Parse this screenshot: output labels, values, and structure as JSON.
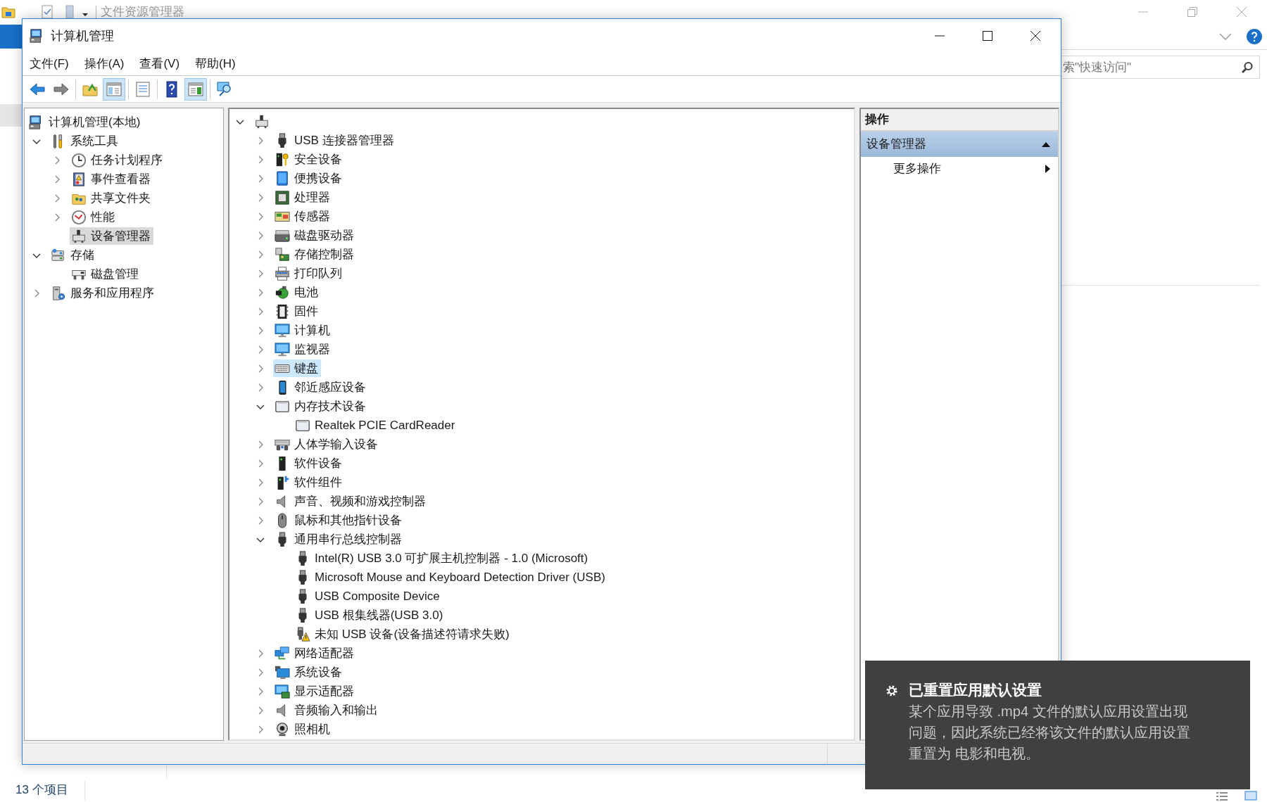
{
  "explorer": {
    "title": "文件资源管理器",
    "search": {
      "placeholder": "索\"快速访问\""
    },
    "status": "13 个项目"
  },
  "window": {
    "title": "计算机管理",
    "menu": [
      "文件(F)",
      "操作(A)",
      "查看(V)",
      "帮助(H)"
    ],
    "toolbar": [
      {
        "pressed": false
      },
      {
        "pressed": false
      },
      {
        "pressed": false
      },
      {
        "pressed": true
      },
      {
        "pressed": false
      },
      {
        "pressed": false
      },
      {
        "pressed": true
      },
      {
        "pressed": false
      }
    ],
    "nav_tree": {
      "label": "计算机管理(本地)",
      "selected": false,
      "children": [
        {
          "label": "系统工具",
          "expanded": true,
          "selected": false,
          "children": [
            {
              "label": "任务计划程序",
              "expanded": false,
              "selected": false
            },
            {
              "label": "事件查看器",
              "expanded": false,
              "selected": false
            },
            {
              "label": "共享文件夹",
              "expanded": false,
              "selected": false
            },
            {
              "label": "性能",
              "expanded": false,
              "selected": false
            },
            {
              "label": "设备管理器",
              "selected": true
            }
          ]
        },
        {
          "label": "存储",
          "expanded": true,
          "selected": false,
          "children": [
            {
              "label": "磁盘管理",
              "selected": false
            }
          ]
        },
        {
          "label": "服务和应用程序",
          "expanded": false,
          "selected": false
        }
      ]
    },
    "device_tree": {
      "expanded": true,
      "selected": false,
      "children": [
        {
          "label": "USB 连接器管理器",
          "expanded": false,
          "selected": false
        },
        {
          "label": "安全设备",
          "expanded": false,
          "selected": false
        },
        {
          "label": "便携设备",
          "expanded": false,
          "selected": false
        },
        {
          "label": "处理器",
          "expanded": false,
          "selected": false
        },
        {
          "label": "传感器",
          "expanded": false,
          "selected": false
        },
        {
          "label": "磁盘驱动器",
          "expanded": false,
          "selected": false
        },
        {
          "label": "存储控制器",
          "expanded": false,
          "selected": false
        },
        {
          "label": "打印队列",
          "expanded": false,
          "selected": false
        },
        {
          "label": "电池",
          "expanded": false,
          "selected": false
        },
        {
          "label": "固件",
          "expanded": false,
          "selected": false
        },
        {
          "label": "计算机",
          "expanded": false,
          "selected": false
        },
        {
          "label": "监视器",
          "expanded": false,
          "selected": false
        },
        {
          "label": "键盘",
          "expanded": false,
          "selected": true
        },
        {
          "label": "邻近感应设备",
          "expanded": false,
          "selected": false
        },
        {
          "label": "内存技术设备",
          "expanded": true,
          "selected": false,
          "children": [
            {
              "label": "Realtek PCIE CardReader",
              "selected": false
            }
          ]
        },
        {
          "label": "人体学输入设备",
          "expanded": false,
          "selected": false
        },
        {
          "label": "软件设备",
          "expanded": false,
          "selected": false
        },
        {
          "label": "软件组件",
          "expanded": false,
          "selected": false
        },
        {
          "label": "声音、视频和游戏控制器",
          "expanded": false,
          "selected": false
        },
        {
          "label": "鼠标和其他指针设备",
          "expanded": false,
          "selected": false
        },
        {
          "label": "通用串行总线控制器",
          "expanded": true,
          "selected": false,
          "children": [
            {
              "label": "Intel(R) USB 3.0 可扩展主机控制器 - 1.0 (Microsoft)",
              "selected": false
            },
            {
              "label": "Microsoft Mouse and Keyboard Detection Driver (USB)",
              "selected": false
            },
            {
              "label": "USB Composite Device",
              "selected": false
            },
            {
              "label": "USB 根集线器(USB 3.0)",
              "selected": false
            },
            {
              "label": "未知 USB 设备(设备描述符请求失败)",
              "selected": false
            }
          ]
        },
        {
          "label": "网络适配器",
          "expanded": false,
          "selected": false
        },
        {
          "label": "系统设备",
          "expanded": false,
          "selected": false
        },
        {
          "label": "显示适配器",
          "expanded": false,
          "selected": false
        },
        {
          "label": "音频输入和输出",
          "expanded": false,
          "selected": false
        },
        {
          "label": "照相机",
          "expanded": false,
          "selected": false
        }
      ]
    },
    "actions": {
      "header": "操作",
      "section": {
        "label": "设备管理器",
        "expanded": true
      },
      "items": [
        "更多操作"
      ]
    }
  },
  "toast": {
    "title": "已重置应用默认设置",
    "body": "某个应用导致 .mp4 文件的默认应用设置出现问题，因此系统已经将该文件的默认应用设置重置为 电影和电视。"
  }
}
